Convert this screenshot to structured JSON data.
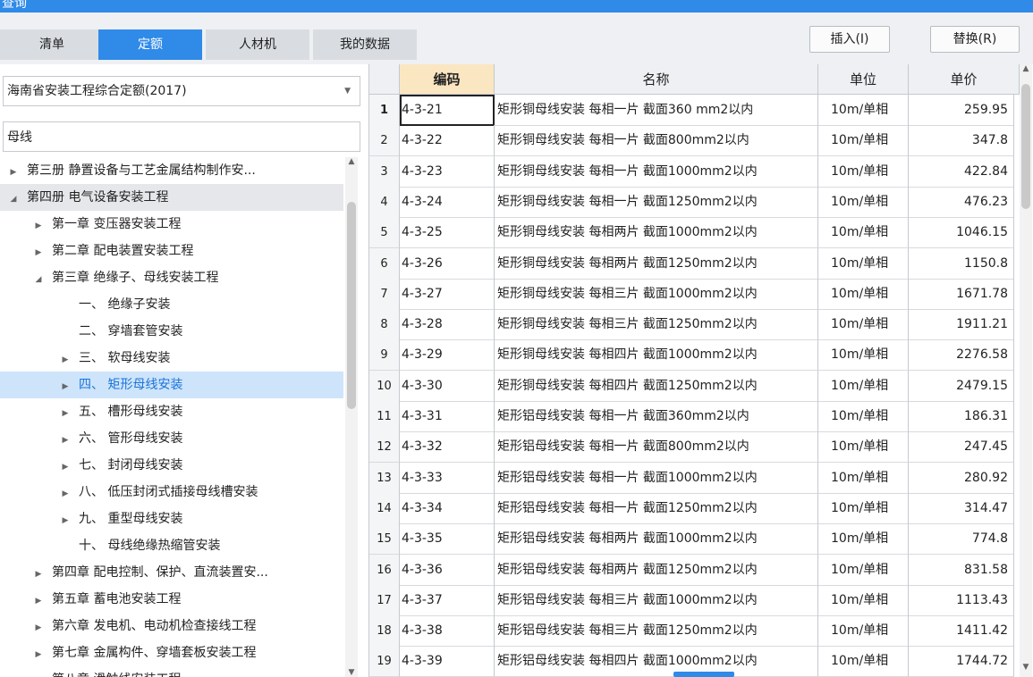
{
  "window": {
    "title": "查询"
  },
  "tabs": [
    {
      "label": "清单"
    },
    {
      "label": "定额"
    },
    {
      "label": "人材机"
    },
    {
      "label": "我的数据"
    }
  ],
  "buttons": {
    "insert": "插入(I)",
    "replace": "替换(R)"
  },
  "colors": {
    "accent": "#2f8ae8",
    "selected_row": "#cde4fa",
    "header_hot": "#fbe6c2"
  },
  "left": {
    "quota_library": "海南省安装工程综合定额(2017)",
    "search_value": "母线",
    "tree": [
      {
        "label": "第三册 静置设备与工艺金属结构制作安...",
        "level": 0,
        "toggle": "collapsed"
      },
      {
        "label": "第四册 电气设备安装工程",
        "level": 0,
        "toggle": "expanded"
      },
      {
        "label": "第一章 变压器安装工程",
        "level": 1,
        "toggle": "collapsed"
      },
      {
        "label": "第二章 配电装置安装工程",
        "level": 1,
        "toggle": "collapsed"
      },
      {
        "label": "第三章 绝缘子、母线安装工程",
        "level": 1,
        "toggle": "expanded"
      },
      {
        "label": "一、 绝缘子安装",
        "level": 2,
        "toggle": "none"
      },
      {
        "label": "二、 穿墙套管安装",
        "level": 2,
        "toggle": "none"
      },
      {
        "label": "三、 软母线安装",
        "level": 2,
        "toggle": "collapsed"
      },
      {
        "label": "四、 矩形母线安装",
        "level": 2,
        "toggle": "collapsed"
      },
      {
        "label": "五、 槽形母线安装",
        "level": 2,
        "toggle": "collapsed"
      },
      {
        "label": "六、 管形母线安装",
        "level": 2,
        "toggle": "collapsed"
      },
      {
        "label": "七、 封闭母线安装",
        "level": 2,
        "toggle": "collapsed"
      },
      {
        "label": "八、 低压封闭式插接母线槽安装",
        "level": 2,
        "toggle": "collapsed"
      },
      {
        "label": "九、 重型母线安装",
        "level": 2,
        "toggle": "collapsed"
      },
      {
        "label": "十、 母线绝缘热缩管安装",
        "level": 2,
        "toggle": "none"
      },
      {
        "label": "第四章 配电控制、保护、直流装置安...",
        "level": 1,
        "toggle": "collapsed"
      },
      {
        "label": "第五章 蓄电池安装工程",
        "level": 1,
        "toggle": "collapsed"
      },
      {
        "label": "第六章 发电机、电动机检查接线工程",
        "level": 1,
        "toggle": "collapsed"
      },
      {
        "label": "第七章 金属构件、穿墙套板安装工程",
        "level": 1,
        "toggle": "collapsed"
      },
      {
        "label": "第八章 滑触线安装工程",
        "level": 1,
        "toggle": "collapsed"
      }
    ]
  },
  "table": {
    "headers": {
      "code": "编码",
      "name": "名称",
      "unit": "单位",
      "price": "单价"
    },
    "rows": [
      {
        "n": "1",
        "code": "4-3-21",
        "name": "矩形铜母线安装 每相一片 截面360 mm2以内",
        "unit": "10m/单相",
        "price": "259.95"
      },
      {
        "n": "2",
        "code": "4-3-22",
        "name": "矩形铜母线安装 每相一片 截面800mm2以内",
        "unit": "10m/单相",
        "price": "347.8"
      },
      {
        "n": "3",
        "code": "4-3-23",
        "name": "矩形铜母线安装 每相一片 截面1000mm2以内",
        "unit": "10m/单相",
        "price": "422.84"
      },
      {
        "n": "4",
        "code": "4-3-24",
        "name": "矩形铜母线安装 每相一片 截面1250mm2以内",
        "unit": "10m/单相",
        "price": "476.23"
      },
      {
        "n": "5",
        "code": "4-3-25",
        "name": "矩形铜母线安装 每相两片 截面1000mm2以内",
        "unit": "10m/单相",
        "price": "1046.15"
      },
      {
        "n": "6",
        "code": "4-3-26",
        "name": "矩形铜母线安装 每相两片 截面1250mm2以内",
        "unit": "10m/单相",
        "price": "1150.8"
      },
      {
        "n": "7",
        "code": "4-3-27",
        "name": "矩形铜母线安装 每相三片 截面1000mm2以内",
        "unit": "10m/单相",
        "price": "1671.78"
      },
      {
        "n": "8",
        "code": "4-3-28",
        "name": "矩形铜母线安装 每相三片 截面1250mm2以内",
        "unit": "10m/单相",
        "price": "1911.21"
      },
      {
        "n": "9",
        "code": "4-3-29",
        "name": "矩形铜母线安装 每相四片 截面1000mm2以内",
        "unit": "10m/单相",
        "price": "2276.58"
      },
      {
        "n": "10",
        "code": "4-3-30",
        "name": "矩形铜母线安装 每相四片 截面1250mm2以内",
        "unit": "10m/单相",
        "price": "2479.15"
      },
      {
        "n": "11",
        "code": "4-3-31",
        "name": "矩形铝母线安装 每相一片 截面360mm2以内",
        "unit": "10m/单相",
        "price": "186.31"
      },
      {
        "n": "12",
        "code": "4-3-32",
        "name": "矩形铝母线安装 每相一片 截面800mm2以内",
        "unit": "10m/单相",
        "price": "247.45"
      },
      {
        "n": "13",
        "code": "4-3-33",
        "name": "矩形铝母线安装 每相一片 截面1000mm2以内",
        "unit": "10m/单相",
        "price": "280.92"
      },
      {
        "n": "14",
        "code": "4-3-34",
        "name": "矩形铝母线安装 每相一片 截面1250mm2以内",
        "unit": "10m/单相",
        "price": "314.47"
      },
      {
        "n": "15",
        "code": "4-3-35",
        "name": "矩形铝母线安装 每相两片 截面1000mm2以内",
        "unit": "10m/单相",
        "price": "774.8"
      },
      {
        "n": "16",
        "code": "4-3-36",
        "name": "矩形铝母线安装 每相两片 截面1250mm2以内",
        "unit": "10m/单相",
        "price": "831.58"
      },
      {
        "n": "17",
        "code": "4-3-37",
        "name": "矩形铝母线安装 每相三片 截面1000mm2以内",
        "unit": "10m/单相",
        "price": "1113.43"
      },
      {
        "n": "18",
        "code": "4-3-38",
        "name": "矩形铝母线安装 每相三片 截面1250mm2以内",
        "unit": "10m/单相",
        "price": "1411.42"
      },
      {
        "n": "19",
        "code": "4-3-39",
        "name": "矩形铝母线安装 每相四片 截面1000mm2以内",
        "unit": "10m/单相",
        "price": "1744.72"
      }
    ]
  },
  "icons": {
    "expanded": "triangle-down-icon",
    "collapsed": "triangle-right-icon",
    "dropdown": "chevron-down-icon"
  }
}
